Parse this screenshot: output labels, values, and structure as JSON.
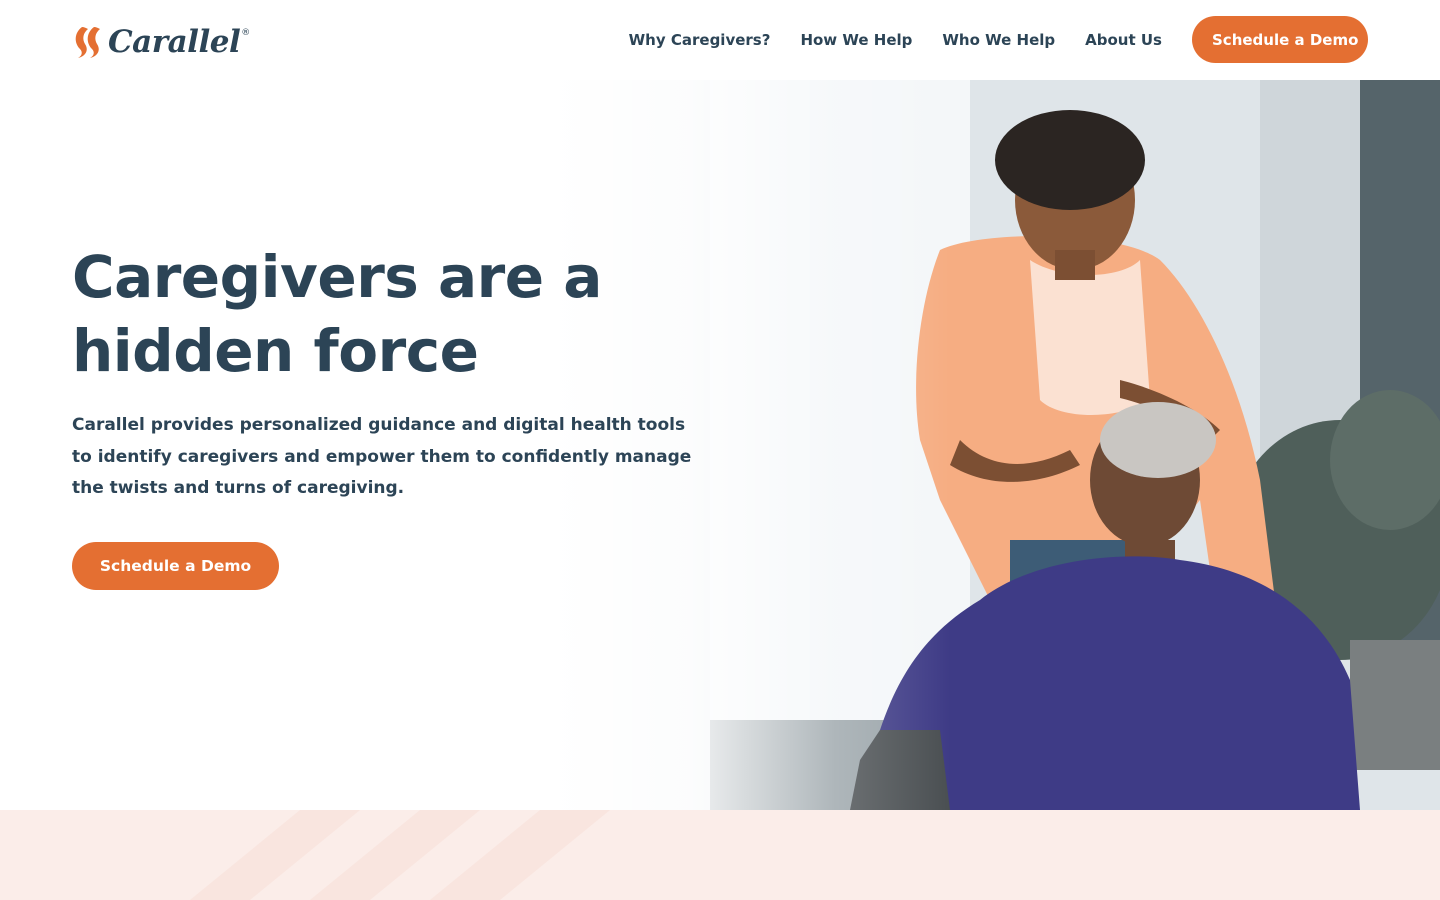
{
  "brand": {
    "name": "Carallel",
    "registered_mark": "®",
    "logo_icon": "flame-swirl-icon",
    "accent_color": "#e46f32",
    "text_color": "#2c4456"
  },
  "nav": {
    "links": [
      {
        "label": "Why Caregivers?"
      },
      {
        "label": "How We Help"
      },
      {
        "label": "Who We Help"
      },
      {
        "label": "About Us"
      }
    ],
    "cta_label": "Schedule a Demo"
  },
  "hero": {
    "title_line1": "Caregivers are a",
    "title_line2": "hidden force",
    "description": "Carallel provides personalized guidance and digital health tools to identify caregivers and empower them to confidently manage the twists and turns of caregiving.",
    "cta_label": "Schedule a Demo"
  },
  "section_band": {
    "background_color": "#fbede9"
  }
}
